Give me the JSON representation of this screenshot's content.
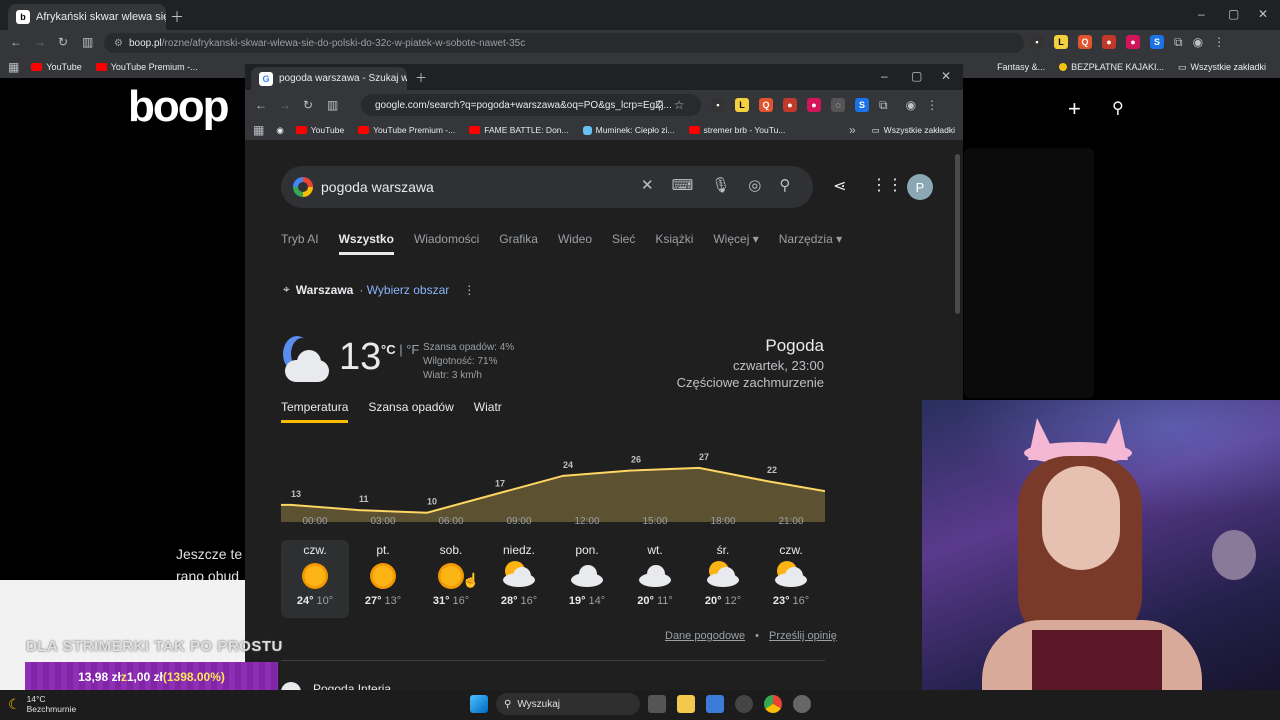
{
  "back_browser": {
    "tab_title": "Afrykański skwar wlewa się do P",
    "url_domain": "boop.pl",
    "url_path": "/rozne/afrykanski-skwar-wlewa-sie-do-polski-do-32c-w-piatek-w-sobote-nawet-35c",
    "bookmarks": [
      "YouTube",
      "YouTube Premium -..."
    ],
    "bookmarks_right": [
      "Fantasy &...",
      "BEZPŁATNE KAJAKI...",
      "Wszystkie zakładki"
    ],
    "logo": "boop",
    "article_text_1": "Jeszcze te",
    "article_text_2": "rano obud"
  },
  "front_browser": {
    "tab_title": "pogoda warszawa - Szukaj w Go",
    "url": "google.com/search?q=pogoda+warszawa&oq=PO&gs_lcrp=EgZj...",
    "bookmarks": [
      "YouTube",
      "YouTube Premium -...",
      "FAME BATTLE: Don...",
      "Muminek: Ciepło zi...",
      "stremer brb - YouTu..."
    ],
    "all_bookmarks": "Wszystkie zakładki"
  },
  "search": {
    "query": "pogoda warszawa",
    "avatar_letter": "P",
    "tabs": [
      "Tryb AI",
      "Wszystko",
      "Wiadomości",
      "Grafika",
      "Wideo",
      "Sieć",
      "Książki",
      "Więcej",
      "Narzędzia"
    ],
    "active_tab": "Wszystko"
  },
  "weather": {
    "location": "Warszawa",
    "location_link": "· Wybierz obszar",
    "temperature": "13",
    "unit_c": "°C",
    "unit_sep": " | ",
    "unit_f": "°F",
    "precip": "Szansa opadów: 4%",
    "humidity": "Wilgotność: 71%",
    "wind": "Wiatr: 3 km/h",
    "title": "Pogoda",
    "datetime": "czwartek, 23:00",
    "condition": "Częściowe zachmurzenie",
    "tabs": [
      "Temperatura",
      "Szansa opadów",
      "Wiatr"
    ],
    "hours": [
      "00:00",
      "03:00",
      "06:00",
      "09:00",
      "12:00",
      "15:00",
      "18:00",
      "21:00"
    ],
    "days": [
      {
        "name": "czw.",
        "hi": "24°",
        "lo": "10°",
        "icon": "sun-icon"
      },
      {
        "name": "pt.",
        "hi": "27°",
        "lo": "13°",
        "icon": "sun-icon"
      },
      {
        "name": "sob.",
        "hi": "31°",
        "lo": "16°",
        "icon": "sun-icon"
      },
      {
        "name": "niedz.",
        "hi": "28°",
        "lo": "16°",
        "icon": "partly-cloudy-icon"
      },
      {
        "name": "pon.",
        "hi": "19°",
        "lo": "14°",
        "icon": "cloud-icon"
      },
      {
        "name": "wt.",
        "hi": "20°",
        "lo": "11°",
        "icon": "cloud-icon"
      },
      {
        "name": "śr.",
        "hi": "20°",
        "lo": "12°",
        "icon": "partly-cloudy-icon"
      },
      {
        "name": "czw.",
        "hi": "23°",
        "lo": "16°",
        "icon": "partly-cloudy-icon"
      }
    ],
    "footer_link_1": "Dane pogodowe",
    "footer_link_2": "Prześlij opinię",
    "next_result": "Pogoda Interia"
  },
  "chart_data": {
    "type": "area",
    "x": [
      "00:00",
      "03:00",
      "06:00",
      "09:00",
      "12:00",
      "15:00",
      "18:00",
      "21:00"
    ],
    "values": [
      13,
      11,
      10,
      17,
      24,
      26,
      27,
      22
    ],
    "ylim": [
      8,
      30
    ],
    "color": "#fdd663"
  },
  "overlay": {
    "promo": "DLA STRIMERKI TAK PO PROSTU",
    "price_from": "13,98 zł",
    "price_mid": " z ",
    "price_to": "1,00 zł",
    "price_pct": " (1398.00%)"
  },
  "taskbar": {
    "weather_temp": "14°C",
    "weather_desc": "Bezchmurnie",
    "search_label": "Wyszukaj"
  }
}
